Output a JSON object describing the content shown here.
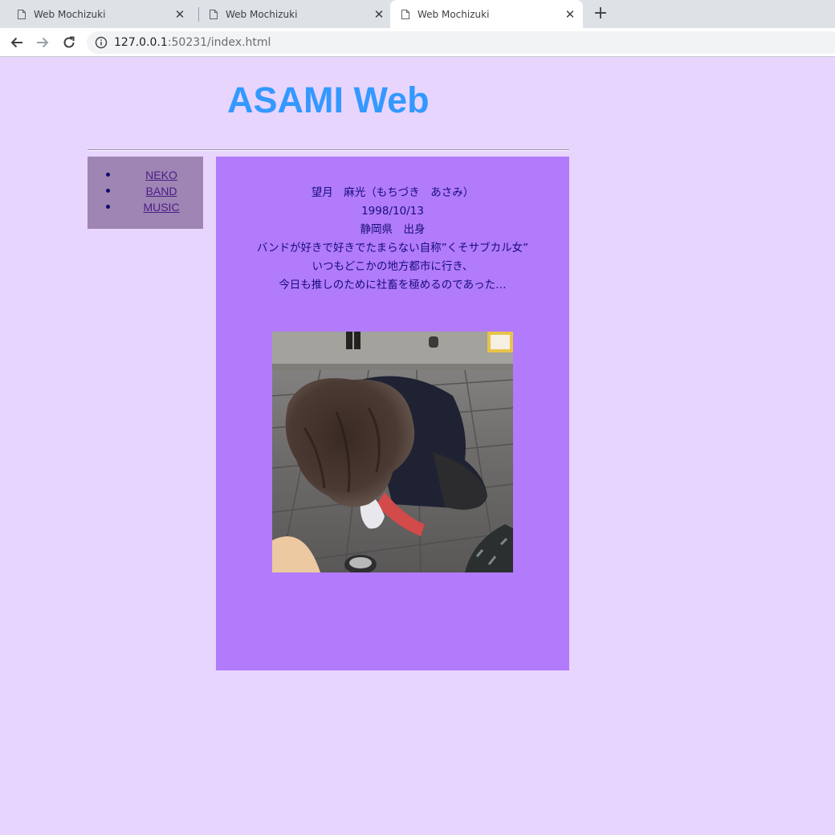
{
  "browser": {
    "tabs": [
      {
        "title": "Web Mochizuki",
        "active": false
      },
      {
        "title": "Web Mochizuki",
        "active": false
      },
      {
        "title": "Web Mochizuki",
        "active": true
      }
    ],
    "url_host": "127.0.0.1",
    "url_rest": ":50231/index.html"
  },
  "site": {
    "title": "ASAMI Web",
    "nav": [
      {
        "label": "NEKO"
      },
      {
        "label": "BAND"
      },
      {
        "label": "MUSIC"
      }
    ],
    "profile": [
      "望月　麻光（もちづき　あさみ）",
      "1998/10/13",
      "静岡県　出身",
      "バンドが好きで好きでたまらない自称”くそサブカル女”",
      "いつもどこかの地方都市に行き、",
      "今日も推しのために社畜を極めるのであった…"
    ]
  },
  "colors": {
    "page_bg": "#e8d5fd",
    "title": "#3399ff",
    "sidebar_bg": "#9e85b3",
    "panel_bg": "#b27bfc",
    "text": "#170e77"
  }
}
